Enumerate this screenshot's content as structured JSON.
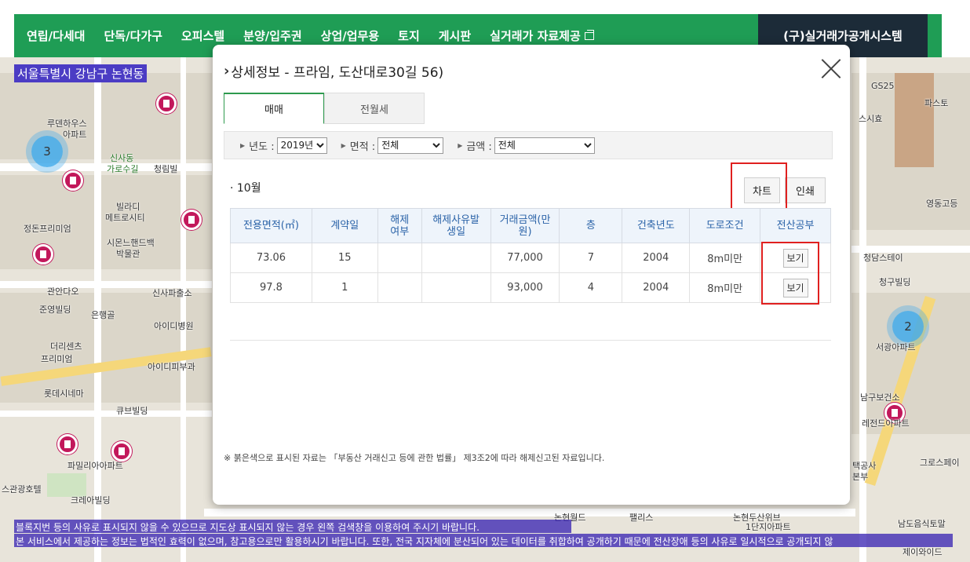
{
  "nav": {
    "items": [
      "연립/다세대",
      "단독/다가구",
      "오피스텔",
      "분양/입주권",
      "상업/업무용",
      "토지",
      "게시판",
      "실거래가 자료제공"
    ],
    "legacy": "(구)실거래가공개시스템"
  },
  "map": {
    "location": "서울특별시 강남구 논현동",
    "clusters": [
      "3",
      "2"
    ],
    "labels": [
      "루덴하우스",
      "아파트",
      "신사동",
      "가로수길",
      "청림빌",
      "빌라디",
      "메트로시티",
      "정돈프리미엄",
      "시몬느핸드백",
      "박물관",
      "관안다오",
      "신사파출소",
      "준영빌딩",
      "은행골",
      "아이디병원",
      "더리센츠",
      "프리미엄",
      "아이디피부과",
      "롯데시네마",
      "큐브빌딩",
      "파밀리아아파트",
      "크레아빌딩",
      "스관광호텔",
      "GS25",
      "파스토",
      "스시효",
      "영동고등",
      "청담스테이",
      "청구빌딩",
      "서광아파트",
      "남구보건소",
      "레전드아파트",
      "그로스페이",
      "택공사",
      "본부",
      "남도음식토말",
      "제이와이드",
      "논현두산위브",
      "1단지아파트",
      "논현월드",
      "팰리스"
    ],
    "notices": [
      "블록지번 등의 사유로 표시되지 않을 수 있으므로 지도상 표시되지 않는 경우 왼쪽 검색창을 이용하여 주시기 바랍니다.",
      "본 서비스에서 제공하는 정보는 법적인 효력이 없으며, 참고용으로만 활용하시기 바랍니다. 또한, 전국 지자체에 분산되어 있는 데이터를 취합하여 공개하기 때문에 전산장애 등의 사유로 일시적으로 공개되지 않"
    ]
  },
  "modal": {
    "title": "상세정보 - 프라임, 도산대로30길 56)",
    "tabs": [
      "매매",
      "전월세"
    ],
    "filters": {
      "year_label": "년도 :",
      "year_value": "2019년",
      "area_label": "면적 :",
      "area_value": "전체",
      "price_label": "금액 :",
      "price_value": "전체"
    },
    "month": "· 10월",
    "chart_button": "차트",
    "print_button": "인쇄",
    "headers": [
      "전용면적(㎡)",
      "계약일",
      "해제여부",
      "해제사유발생일",
      "거래금액(만원)",
      "층",
      "건축년도",
      "도로조건",
      "전산공부"
    ],
    "rows": [
      [
        "73.06",
        "15",
        "",
        "",
        "77,000",
        "7",
        "2004",
        "8m미만",
        "보기"
      ],
      [
        "97.8",
        "1",
        "",
        "",
        "93,000",
        "4",
        "2004",
        "8m미만",
        "보기"
      ]
    ],
    "footnote": "※ 붉은색으로 표시된 자료는 「부동산 거래신고 등에 관한 법률」 제3조2에 따라 해제신고된 자료입니다."
  }
}
